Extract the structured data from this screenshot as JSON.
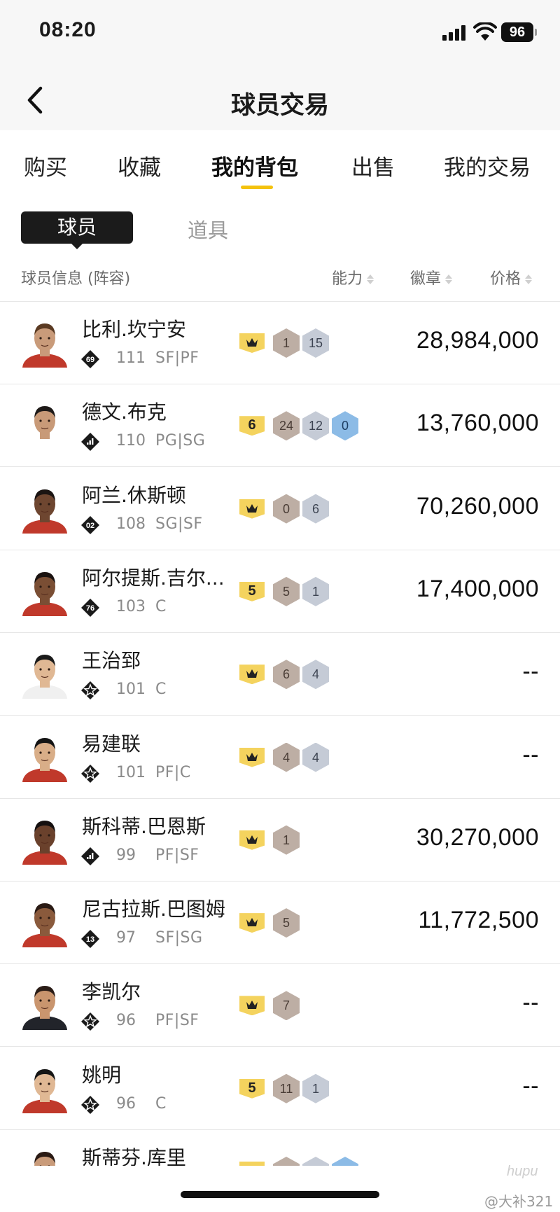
{
  "status_bar": {
    "time": "08:20",
    "battery": "96"
  },
  "header": {
    "title": "球员交易"
  },
  "tabs": [
    {
      "label": "购买",
      "active": false
    },
    {
      "label": "收藏",
      "active": false
    },
    {
      "label": "我的背包",
      "active": true
    },
    {
      "label": "出售",
      "active": false
    },
    {
      "label": "我的交易",
      "active": false
    }
  ],
  "segments": {
    "selected": "球员",
    "other": "道具"
  },
  "columns": {
    "info": "球员信息 (阵容)",
    "ability": "能力",
    "badges": "徽章",
    "price": "价格"
  },
  "players": [
    {
      "name": "比利.坎宁安",
      "tier": "69",
      "ovr": "111",
      "pos": "SF|PF",
      "level": "crown",
      "badges": [
        [
          "1",
          "bronze"
        ],
        [
          "15",
          "silver"
        ]
      ],
      "price": "28,984,000",
      "skin": "#c99b7a",
      "hair": "#5a3a22",
      "jersey": "#c0392b"
    },
    {
      "name": "德文.布克",
      "tier": "bars",
      "ovr": "110",
      "pos": "PG|SG",
      "level": "6",
      "badges": [
        [
          "24",
          "bronze"
        ],
        [
          "12",
          "silver"
        ],
        [
          "0",
          "blue"
        ]
      ],
      "price": "13,760,000",
      "skin": "#c89a78",
      "hair": "#1e1a18",
      "jersey": "#ffffff"
    },
    {
      "name": "阿兰.休斯顿",
      "tier": "02",
      "ovr": "108",
      "pos": "SG|SF",
      "level": "crown",
      "badges": [
        [
          "0",
          "bronze"
        ],
        [
          "6",
          "silver"
        ]
      ],
      "price": "70,260,000",
      "skin": "#6e4630",
      "hair": "#1a1412",
      "jersey": "#c0392b"
    },
    {
      "name": "阿尔提斯.吉尔...",
      "tier": "76",
      "ovr": "103",
      "pos": "C",
      "level": "5",
      "badges": [
        [
          "5",
          "bronze"
        ],
        [
          "1",
          "silver"
        ]
      ],
      "price": "17,400,000",
      "skin": "#7a4e34",
      "hair": "#1a1210",
      "jersey": "#c0392b"
    },
    {
      "name": "王治郅",
      "tier": "star",
      "ovr": "101",
      "pos": "C",
      "level": "crown",
      "badges": [
        [
          "6",
          "bronze"
        ],
        [
          "4",
          "silver"
        ]
      ],
      "price": "--",
      "skin": "#e0b894",
      "hair": "#1a1a1a",
      "jersey": "#f0f0f0"
    },
    {
      "name": "易建联",
      "tier": "star",
      "ovr": "101",
      "pos": "PF|C",
      "level": "crown",
      "badges": [
        [
          "4",
          "bronze"
        ],
        [
          "4",
          "silver"
        ]
      ],
      "price": "--",
      "skin": "#d9ae88",
      "hair": "#141414",
      "jersey": "#c0392b"
    },
    {
      "name": "斯科蒂.巴恩斯",
      "tier": "bars",
      "ovr": "99",
      "pos": "PF|SF",
      "level": "crown",
      "badges": [
        [
          "1",
          "bronze"
        ]
      ],
      "price": "30,270,000",
      "skin": "#6a412c",
      "hair": "#151010",
      "jersey": "#c0392b"
    },
    {
      "name": "尼古拉斯.巴图姆",
      "tier": "13",
      "ovr": "97",
      "pos": "SF|SG",
      "level": "crown",
      "badges": [
        [
          "5",
          "bronze"
        ]
      ],
      "price": "11,772,500",
      "skin": "#8a5a3c",
      "hair": "#2a1a14",
      "jersey": "#c0392b"
    },
    {
      "name": "李凯尔",
      "tier": "star",
      "ovr": "96",
      "pos": "PF|SF",
      "level": "crown",
      "badges": [
        [
          "7",
          "bronze"
        ]
      ],
      "price": "--",
      "skin": "#c9956e",
      "hair": "#2a1c16",
      "jersey": "#22242a"
    },
    {
      "name": "姚明",
      "tier": "star",
      "ovr": "96",
      "pos": "C",
      "level": "5",
      "badges": [
        [
          "11",
          "bronze"
        ],
        [
          "1",
          "silver"
        ]
      ],
      "price": "--",
      "skin": "#e0b894",
      "hair": "#151515",
      "jersey": "#c0392b"
    },
    {
      "name": "斯蒂芬.库里",
      "tier": "star",
      "ovr": "",
      "pos": "",
      "level": "crown",
      "badges": [
        [
          "",
          "bronze"
        ],
        [
          "",
          "silver"
        ],
        [
          "",
          "blue"
        ]
      ],
      "price": "",
      "skin": "#c99b7a",
      "hair": "#2a1a14",
      "jersey": "#1d428a"
    }
  ],
  "watermark": {
    "logo": "hupu",
    "user": "@大补321"
  }
}
